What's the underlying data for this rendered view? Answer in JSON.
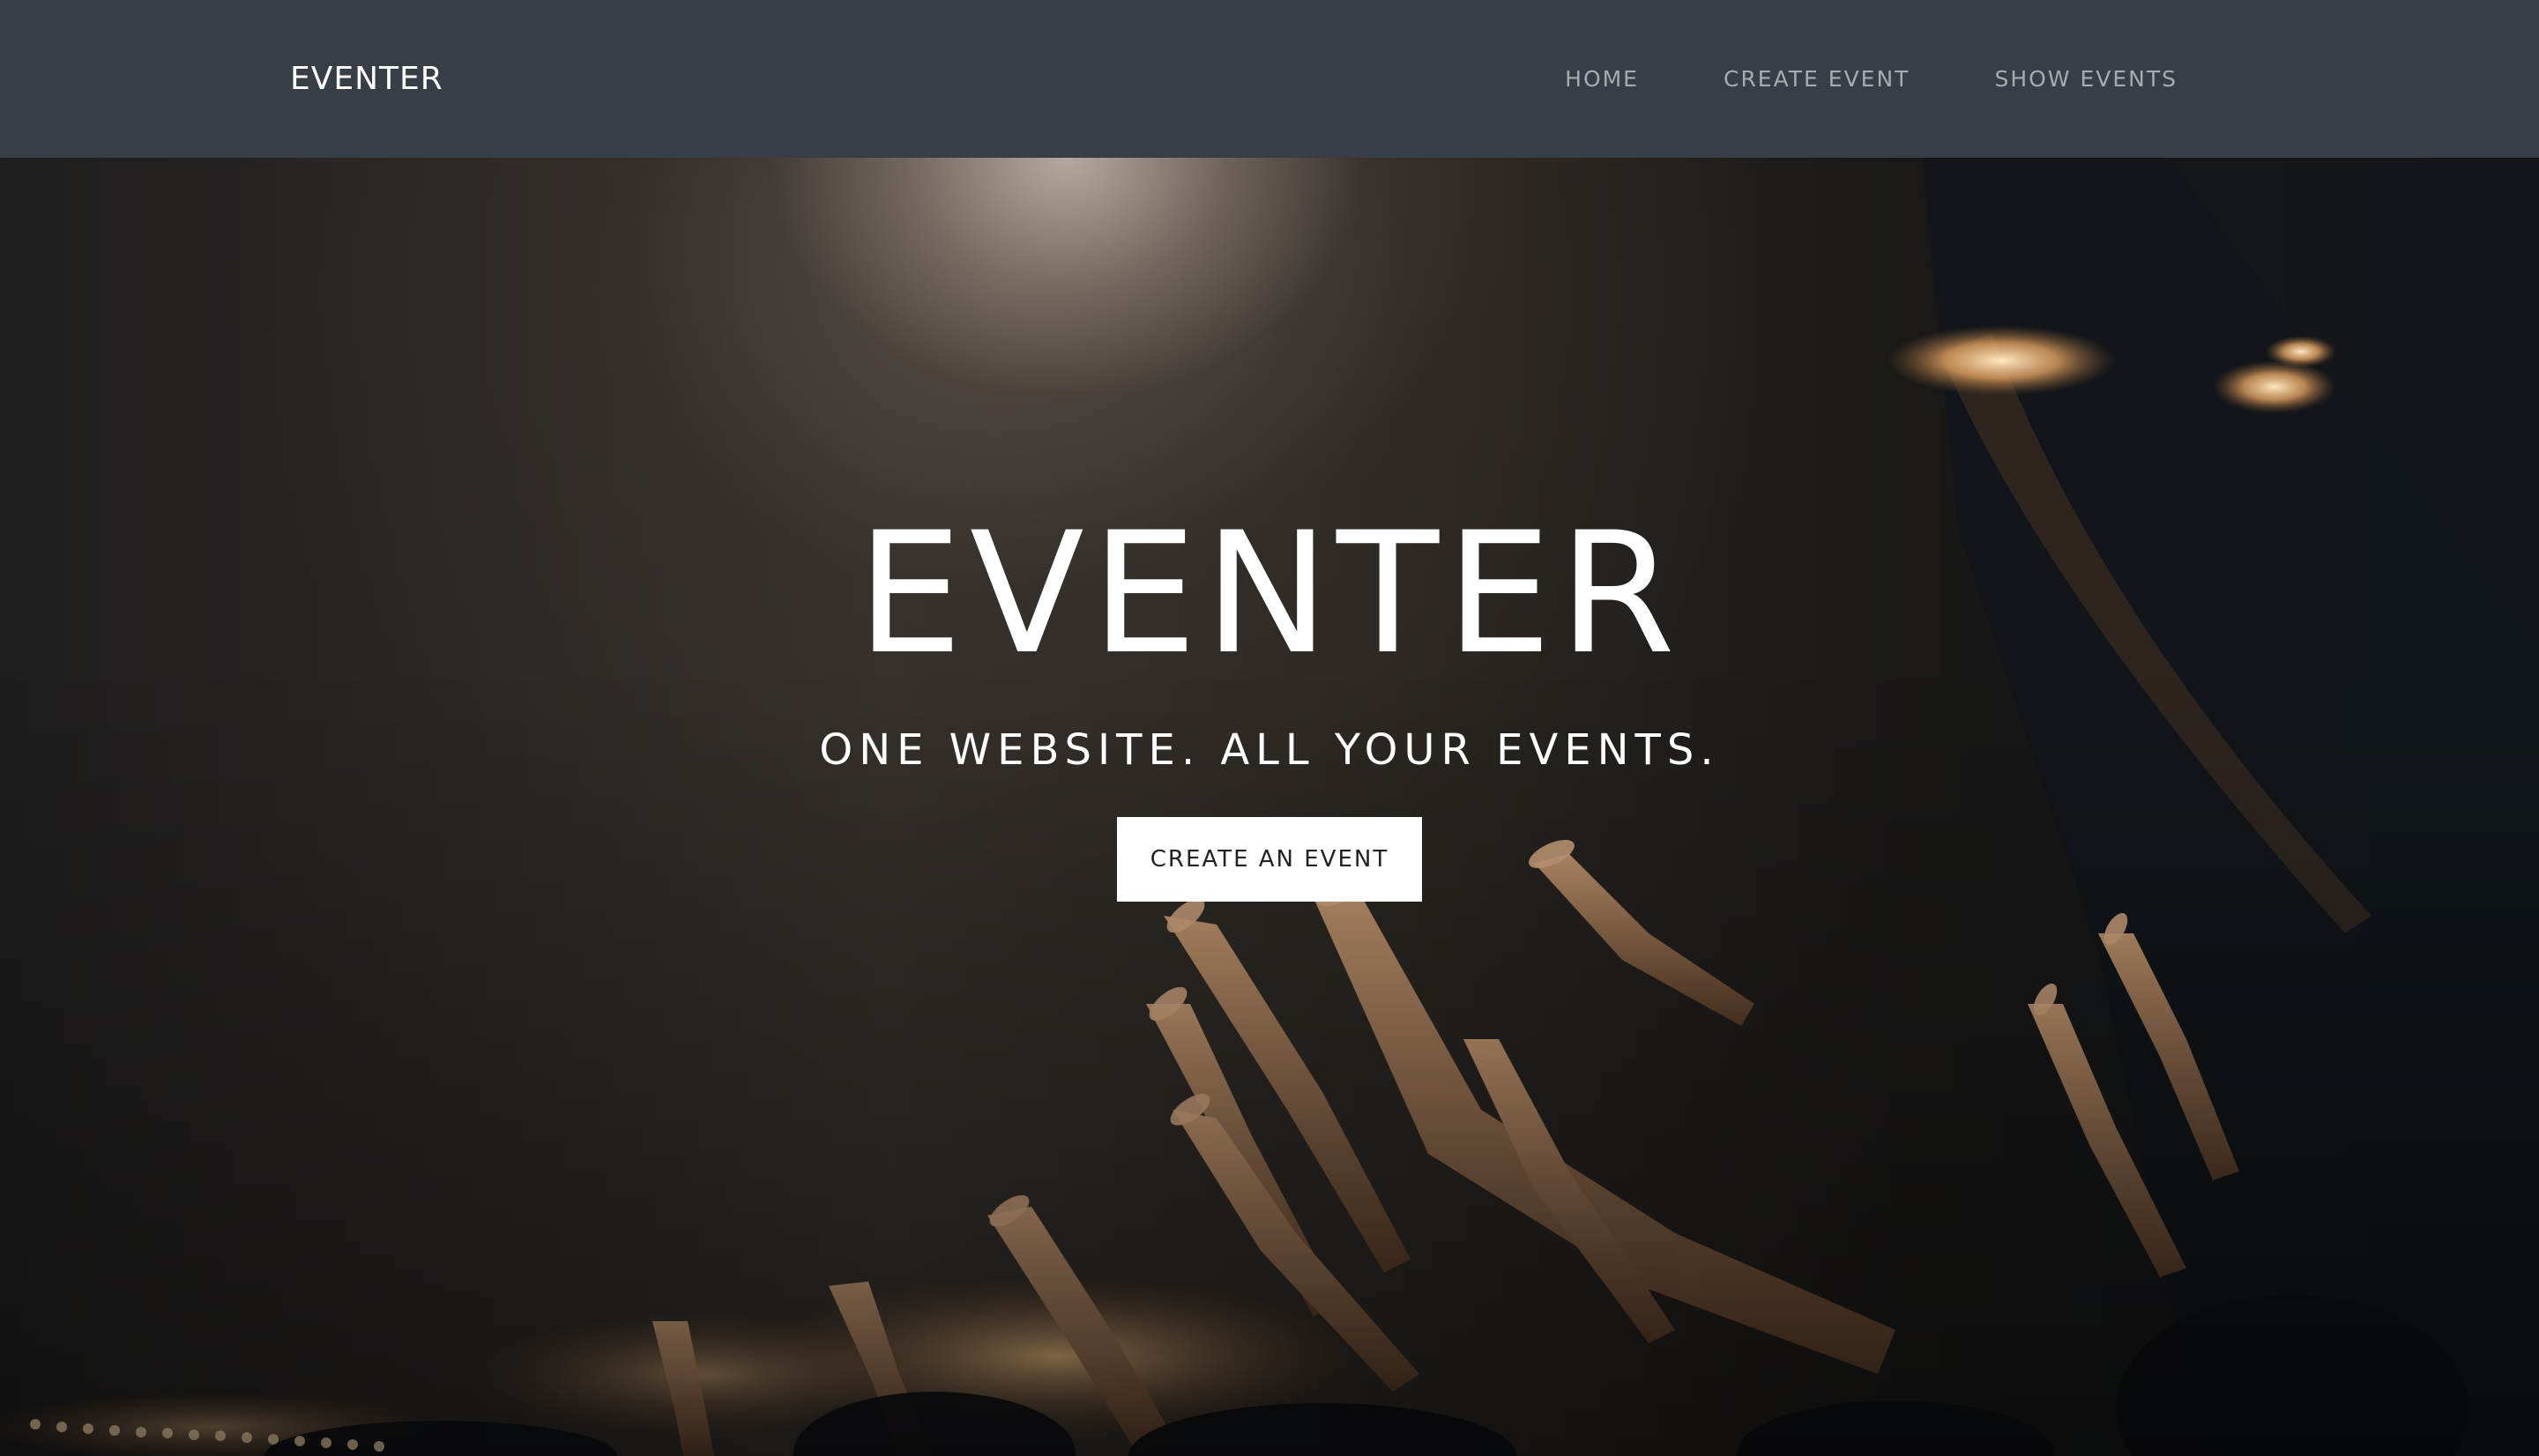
{
  "navbar": {
    "brand": "EVENTER",
    "links": [
      "HOME",
      "CREATE EVENT",
      "SHOW EVENTS"
    ]
  },
  "hero": {
    "title": "EVENTER",
    "subtitle": "ONE WEBSITE. ALL YOUR EVENTS.",
    "button_label": "CREATE AN EVENT"
  },
  "colors": {
    "navbar_bg": "#383e46",
    "nav_link": "#a6abb2",
    "button_bg": "#ffffff"
  }
}
